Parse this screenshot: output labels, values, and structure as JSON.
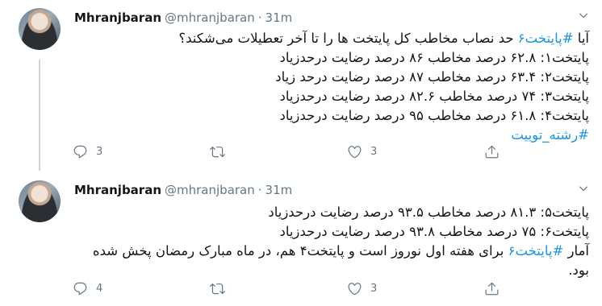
{
  "tweets": [
    {
      "name": "Mhranjbaran",
      "handle": "@mhranjbaran",
      "dot": "·",
      "time": "31m",
      "lines": [
        {
          "pre": "آیا ",
          "tag": "#پایتخت۶",
          "post": " حد نصاب مخاطب کل پایتخت ها را تا آخر تعطیلات می‌شکند؟"
        },
        {
          "text": "پایتخت۱: ۶۲.۸ درصد مخاطب ۸۶ درصد رضایت درحدزیاد"
        },
        {
          "text": "پایتخت۲: ۶۳.۴ درصد مخاطب ۸۷ درصد رضایت درحد زیاد"
        },
        {
          "text": "پایتخت۳: ۷۴ درصد مخاطب ۸۲.۶ درصد رضایت درحدزیاد"
        },
        {
          "text": "پایتخت۴: ۶۱.۸ درصد مخاطب ۹۵ درصد رضایت درحدزیاد"
        },
        {
          "tag": "#رشته_توییت"
        }
      ],
      "replies": "3",
      "retweets": "",
      "likes": "3"
    },
    {
      "name": "Mhranjbaran",
      "handle": "@mhranjbaran",
      "dot": "·",
      "time": "31m",
      "lines": [
        {
          "text": "پایتخت۵: ۸۱.۳ درصد مخاطب ۹۳.۵ درصد رضایت درحدزیاد"
        },
        {
          "text": "پایتخت۶: ۷۵ درصد مخاطب ۹۳.۸ درصد رضایت درحدزیاد"
        },
        {
          "pre": "آمار ",
          "tag": "#پایتخت۶",
          "post": " برای هفته اول نوروز است و پایتخت۴ هم، در ماه مبارک رمضان پخش شده بود."
        }
      ],
      "replies": "4",
      "retweets": "",
      "likes": "3"
    }
  ]
}
